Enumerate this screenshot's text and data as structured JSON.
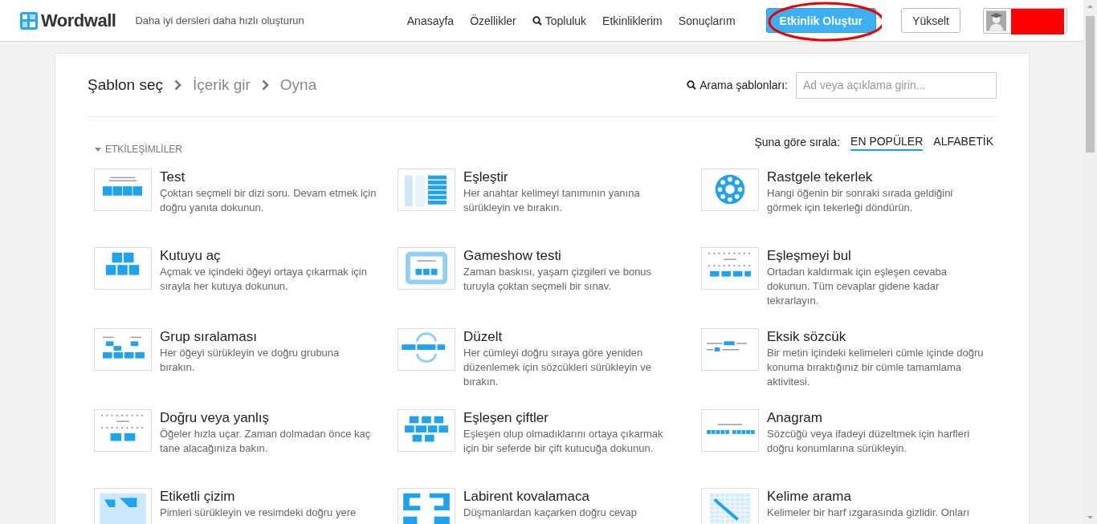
{
  "header": {
    "logo": "Wordwall",
    "tagline": "Daha iyi dersleri daha hızlı oluşturun",
    "nav": [
      {
        "label": "Anasayfa",
        "kind": "plain"
      },
      {
        "label": "Özellikler",
        "kind": "plain"
      },
      {
        "label": "Topluluk",
        "kind": "search"
      },
      {
        "label": "Etkinliklerim",
        "kind": "plain"
      },
      {
        "label": "Sonuçlarım",
        "kind": "plain"
      }
    ],
    "create_button": {
      "label": "Etkinlik Oluştur",
      "circled": true
    },
    "upgrade_button": "Yükselt",
    "account": {
      "name_redacted": true
    }
  },
  "breadcrumb": [
    {
      "label": "Şablon seç",
      "selected": true
    },
    {
      "label": "İçerik gir",
      "selected": false
    },
    {
      "label": "Oyna",
      "selected": false
    }
  ],
  "search": {
    "label": "Arama şablonları:",
    "placeholder": "Ad veya açıklama girin..."
  },
  "section": {
    "title": "ETKİLEŞİMLİLER",
    "expanded": true
  },
  "sort": {
    "label": "Şuna göre sırala:",
    "options": [
      {
        "label": "EN POPÜLER",
        "selected": true
      },
      {
        "label": "ALFABETİK",
        "selected": false
      }
    ]
  },
  "templates": [
    {
      "title": "Test",
      "description": "Çoktan seçmeli bir dizi soru. Devam etmek için doğru yanıta dokunun.",
      "kind": "quiz"
    },
    {
      "title": "Eşleştir",
      "description": "Her anahtar kelimeyi tanımının yanına sürükleyin ve bırakın.",
      "kind": "match"
    },
    {
      "title": "Rastgele tekerlek",
      "description": "Hangi öğenin bir sonraki sırada geldiğini görmek için tekerleği döndürün.",
      "kind": "wheel"
    },
    {
      "title": "Kutuyu aç",
      "description": "Açmak ve içindeki öğeyi ortaya çıkarmak için sırayla her kutuya dokunun.",
      "kind": "boxes"
    },
    {
      "title": "Gameshow testi",
      "description": "Zaman baskısı, yaşam çizgileri ve bonus turuyla çoktan seçmeli bir sınav.",
      "kind": "gameshow"
    },
    {
      "title": "Eşleşmeyi bul",
      "description": "Ortadan kaldırmak için eşleşen cevaba dokunun. Tüm cevaplar gidene kadar tekrarlayın.",
      "kind": "find"
    },
    {
      "title": "Grup sıralaması",
      "description": "Her öğeyi sürükleyin ve doğru grubuna bırakın.",
      "kind": "group"
    },
    {
      "title": "Düzelt",
      "description": "Her cümleyi doğru sıraya göre yeniden düzenlemek için sözcükleri sürükleyin ve bırakın.",
      "kind": "unjumble"
    },
    {
      "title": "Eksik sözcük",
      "description": "Bir metin içindeki kelimeleri cümle içinde doğru konuma bıraktığınız bir cümle tamamlama aktivitesi.",
      "kind": "missing"
    },
    {
      "title": "Doğru veya yanlış",
      "description": "Öğeler hızla uçar. Zaman dolmadan önce kaç tane alacağınıza bakın.",
      "kind": "truefalse"
    },
    {
      "title": "Eşleşen çiftler",
      "description": "Eşleşen olup olmadıklarını ortaya çıkarmak için bir seferde bir çift kutucuğa dokunun.",
      "kind": "pairs"
    },
    {
      "title": "Anagram",
      "description": "Sözcüğü veya ifadeyi düzeltmek için harfleri doğru konumlarına sürükleyin.",
      "kind": "anagram"
    },
    {
      "title": "Etiketli çizim",
      "description": "Pimleri sürükleyin ve resimdeki doğru yere",
      "kind": "diagram"
    },
    {
      "title": "Labirent kovalamaca",
      "description": "Düşmanlardan kaçarken doğru cevap",
      "kind": "maze"
    },
    {
      "title": "Kelime arama",
      "description": "Kelimeler bir harf ızgarasında gizlidir. Onları",
      "kind": "wordsearch"
    }
  ]
}
